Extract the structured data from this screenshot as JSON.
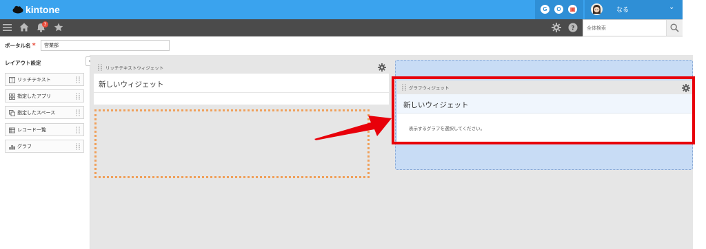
{
  "header": {
    "logo_text": "kintone",
    "services": [
      {
        "label": "G",
        "icon": "garoon-icon"
      },
      {
        "label": "O",
        "icon": "office-icon"
      },
      {
        "label": "▣",
        "icon": "mailwise-icon"
      }
    ],
    "user_name": "なる",
    "accent": "#3aa3ee",
    "accent_dark": "#2f8fd6"
  },
  "toolbar": {
    "notification_count": "3",
    "search_placeholder": "全体検索",
    "bar_color": "#4b4b4b"
  },
  "portal": {
    "name_label": "ポータル名",
    "required_mark": "*",
    "name_value": "営業部"
  },
  "sidebar": {
    "title": "レイアウト設定",
    "items": [
      {
        "label": "リッチテキスト",
        "icon": "rich-text-icon"
      },
      {
        "label": "指定したアプリ",
        "icon": "app-grid-icon"
      },
      {
        "label": "指定したスペース",
        "icon": "space-icon"
      },
      {
        "label": "レコード一覧",
        "icon": "record-list-icon"
      },
      {
        "label": "グラフ",
        "icon": "graph-icon"
      }
    ]
  },
  "widgets": {
    "richtext": {
      "header_title": "リッチテキストウィジェット",
      "name": "新しいウィジェット"
    },
    "graph": {
      "header_title": "グラフウィジェット",
      "name": "新しいウィジェット",
      "message": "表示するグラフを選択してください。"
    }
  },
  "annotation": {
    "highlight_color": "#e8000a",
    "drop_zone_color": "#f0a05a"
  }
}
